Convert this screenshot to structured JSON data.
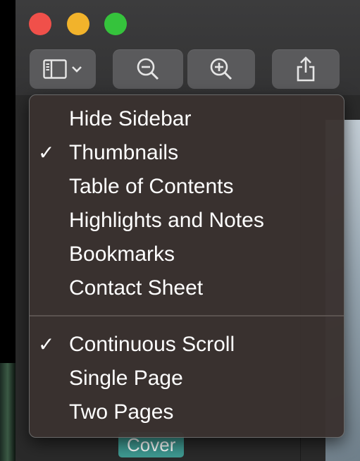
{
  "colors": {
    "close": "#f0504a",
    "minimize": "#f2b32b",
    "maximize": "#35c33c",
    "menu_background": "#3a3230",
    "cover_badge": "#3f9a92"
  },
  "toolbar": {
    "sidebar_icon": "sidebar-icon",
    "chevron_icon": "chevron-down-icon",
    "zoom_out_icon": "zoom-out-icon",
    "zoom_in_icon": "zoom-in-icon",
    "share_icon": "share-icon"
  },
  "menu": {
    "group1": [
      {
        "label": "Hide Sidebar",
        "checked": false
      },
      {
        "label": "Thumbnails",
        "checked": true
      },
      {
        "label": "Table of Contents",
        "checked": false
      },
      {
        "label": "Highlights and Notes",
        "checked": false
      },
      {
        "label": "Bookmarks",
        "checked": false
      },
      {
        "label": "Contact Sheet",
        "checked": false
      }
    ],
    "group2": [
      {
        "label": "Continuous Scroll",
        "checked": true
      },
      {
        "label": "Single Page",
        "checked": false
      },
      {
        "label": "Two Pages",
        "checked": false
      }
    ],
    "check_glyph": "✓"
  },
  "sidebar": {
    "thumbnail_label": "Cover"
  }
}
